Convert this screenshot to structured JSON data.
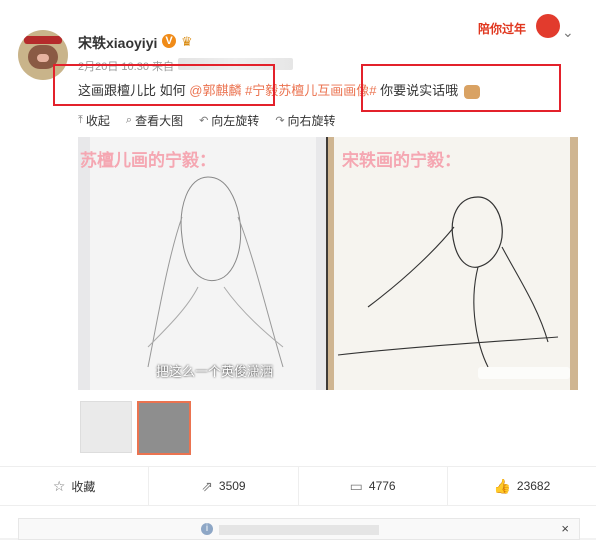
{
  "post": {
    "username": "宋轶xiaoyiyi",
    "verified_badge": "V",
    "time": "2月20日 10:30 来自",
    "text_prefix": "这画跟檀儿比 如何",
    "mention": "@郭麒麟",
    "topic": " #宁毅苏檀儿互画画像#",
    "text_suffix": " 你要说实话哦"
  },
  "header": {
    "promo_text": "陪你过年"
  },
  "toolbar": {
    "collapse": "收起",
    "view_large": "查看大图",
    "rotate_left": "向左旋转",
    "rotate_right": "向右旋转"
  },
  "image": {
    "left_caption": "苏檀儿画的宁毅：",
    "right_caption": "宋轶画的宁毅：",
    "subtitle": "把这么一个英俊潇洒"
  },
  "actions": {
    "favorite": "收藏",
    "repost": "3509",
    "comments": "4776",
    "likes": "23682"
  },
  "colors": {
    "accent": "#eb7350",
    "highlight_box": "#e3212b"
  },
  "icons": [
    "chevron-down-icon",
    "collapse-icon",
    "view-large-icon",
    "rotate-left-icon",
    "rotate-right-icon",
    "star-icon",
    "repost-icon",
    "comment-icon",
    "like-icon",
    "info-icon",
    "close-icon"
  ]
}
